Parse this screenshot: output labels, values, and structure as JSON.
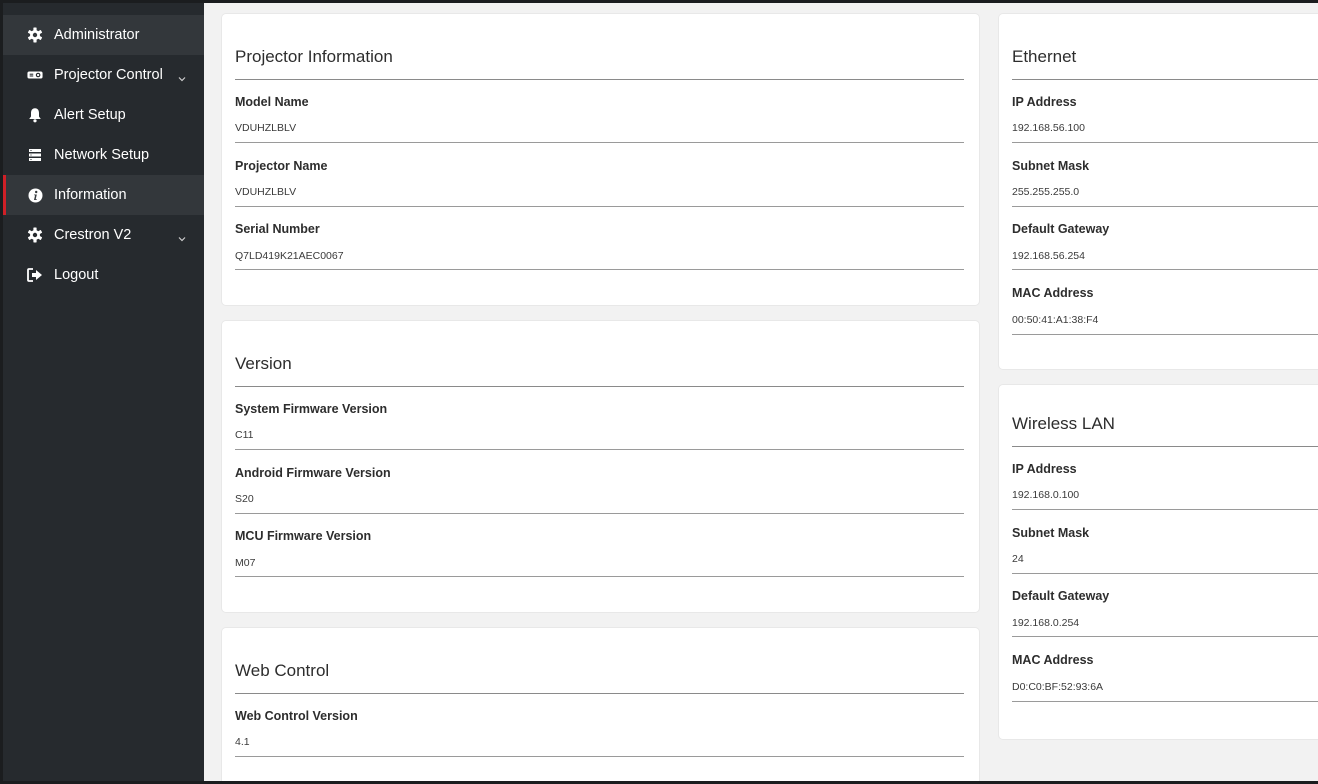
{
  "sidebar": {
    "items": [
      {
        "label": "Administrator",
        "icon": "gear-icon"
      },
      {
        "label": "Projector Control",
        "icon": "projector-icon",
        "has_submenu": true
      },
      {
        "label": "Alert Setup",
        "icon": "bell-icon"
      },
      {
        "label": "Network Setup",
        "icon": "server-icon"
      },
      {
        "label": "Information",
        "icon": "info-icon",
        "active": true
      },
      {
        "label": "Crestron V2",
        "icon": "gear-icon",
        "has_submenu": true
      },
      {
        "label": "Logout",
        "icon": "logout-icon"
      }
    ]
  },
  "projector_info": {
    "title": "Projector Information",
    "model_name_label": "Model Name",
    "model_name_value": "VDUHZLBLV",
    "projector_name_label": "Projector Name",
    "projector_name_value": "VDUHZLBLV",
    "serial_number_label": "Serial Number",
    "serial_number_value": "Q7LD419K21AEC0067"
  },
  "version": {
    "title": "Version",
    "system_fw_label": "System Firmware Version",
    "system_fw_value": "C11",
    "android_fw_label": "Android Firmware Version",
    "android_fw_value": "S20",
    "mcu_fw_label": "MCU Firmware Version",
    "mcu_fw_value": "M07"
  },
  "web_control": {
    "title": "Web Control",
    "version_label": "Web Control Version",
    "version_value": "4.1"
  },
  "ethernet": {
    "title": "Ethernet",
    "ip_label": "IP Address",
    "ip_value": "192.168.56.100",
    "subnet_label": "Subnet Mask",
    "subnet_value": "255.255.255.0",
    "gateway_label": "Default Gateway",
    "gateway_value": "192.168.56.254",
    "mac_label": "MAC Address",
    "mac_value": "00:50:41:A1:38:F4"
  },
  "wireless": {
    "title": "Wireless LAN",
    "ip_label": "IP Address",
    "ip_value": "192.168.0.100",
    "subnet_label": "Subnet Mask",
    "subnet_value": "24",
    "gateway_label": "Default Gateway",
    "gateway_value": "192.168.0.254",
    "mac_label": "MAC Address",
    "mac_value": "D0:C0:BF:52:93:6A"
  },
  "colors": {
    "sidebar_bg": "#262a2e",
    "active_bg": "#33373b",
    "active_accent": "#d02027",
    "main_bg": "#f2f2f2",
    "card_bg": "#ffffff"
  }
}
